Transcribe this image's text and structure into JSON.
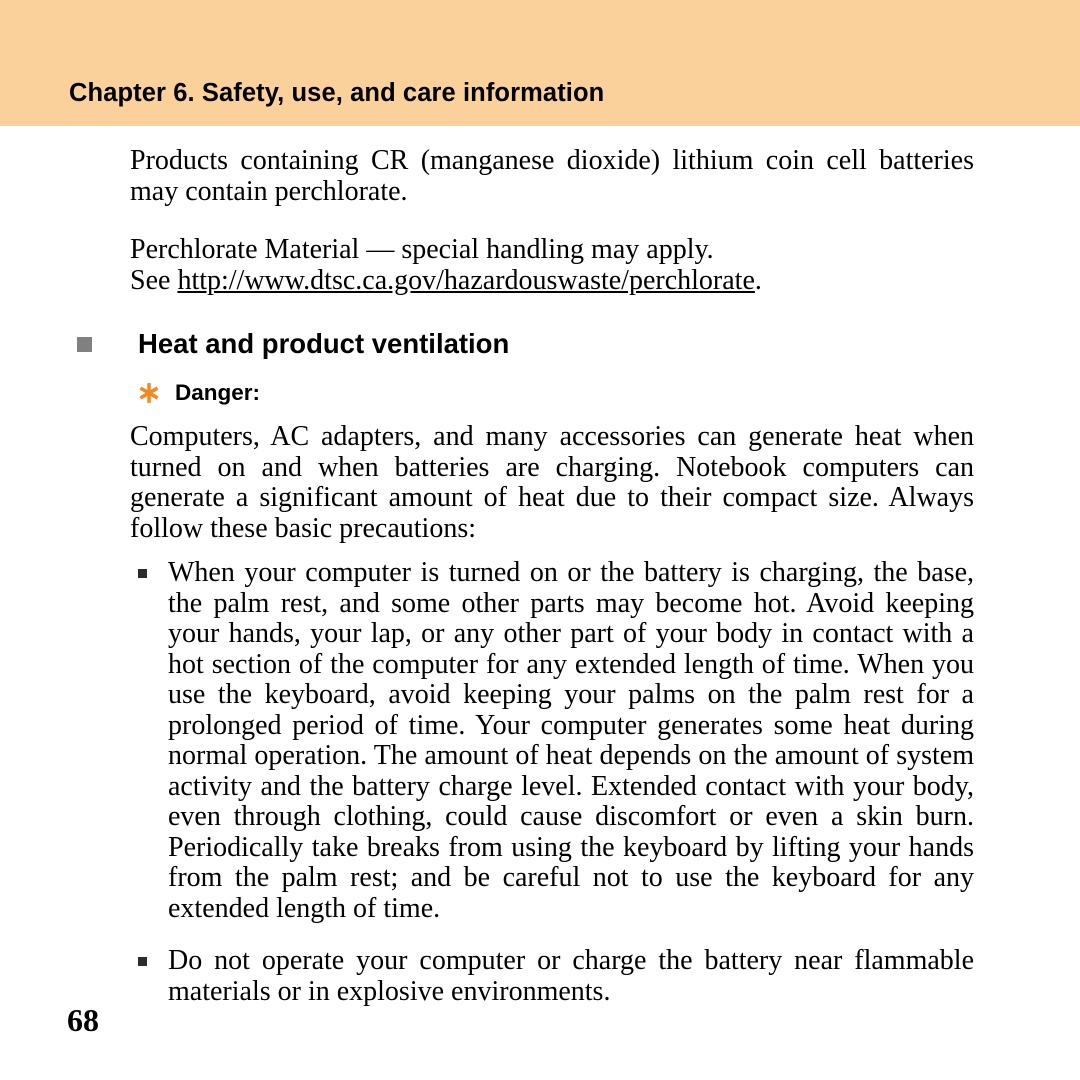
{
  "header": {
    "chapter_title": "Chapter 6. Safety, use, and care information",
    "band_color": "#fbd19b"
  },
  "content": {
    "paragraph_perchlorate": "Products containing CR (manganese dioxide) lithium coin cell batteries may contain perchlorate.",
    "paragraph_material_line1": "Perchlorate Material — special handling may apply.",
    "paragraph_material_line2_prefix": "See ",
    "paragraph_material_url": "http://www.dtsc.ca.gov/hazardouswaste/perchlorate",
    "paragraph_material_line2_suffix": ".",
    "section_heading": "Heat and product ventilation",
    "section_bullet_color": "#808080",
    "danger_label": "Danger:",
    "danger_icon_color": "#f5881f",
    "danger_icon_name": "asterisk-burst-icon",
    "paragraph_heat": "Computers, AC adapters, and many accessories can generate heat when turned on and when batteries are charging. Notebook computers can generate a significant amount of heat due to their compact size. Always follow these basic precautions:",
    "bullets": [
      "When your computer is turned on or the battery is charging, the base, the palm rest, and some other parts may become hot. Avoid keeping your hands, your lap, or any other part of your body in contact with a hot section of the computer for any extended length of time. When you use the keyboard, avoid keeping your palms on the palm rest for a prolonged period of time. Your computer generates some heat during normal operation. The amount of heat depends on the amount of system activity and the battery charge level. Extended contact with your body, even through clothing, could cause discomfort or even a skin burn. Periodically take breaks from using the keyboard by lifting your hands from the palm rest; and be careful not to use the keyboard for any extended length of time.",
      "Do not operate your computer or charge the battery near flammable materials or in explosive environments."
    ]
  },
  "footer": {
    "page_number": "68"
  }
}
